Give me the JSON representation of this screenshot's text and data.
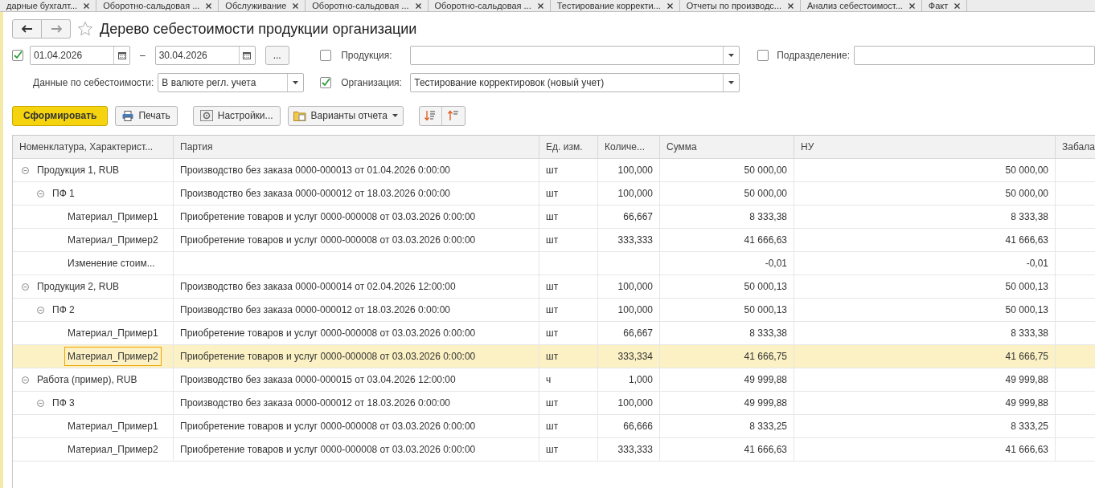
{
  "open_tabs": [
    {
      "label": "дарные бухгалт...",
      "selected": false
    },
    {
      "label": "Оборотно-сальдовая ...",
      "selected": false
    },
    {
      "label": "Обслуживание",
      "selected": false
    },
    {
      "label": "Оборотно-сальдовая ...",
      "selected": false
    },
    {
      "label": "Оборотно-сальдовая ...",
      "selected": false
    },
    {
      "label": "Тестирование корректи...",
      "selected": false
    },
    {
      "label": "Отчеты по производс...",
      "selected": false
    },
    {
      "label": "Анализ себестоимост...",
      "selected": false
    },
    {
      "label": "Факт",
      "selected": false
    }
  ],
  "window": {
    "title": "Дерево себестоимости продукции организации",
    "favorite": false
  },
  "period": {
    "enabled": true,
    "from": "01.04.2026",
    "dash": "–",
    "to": "30.04.2026",
    "more_button": "..."
  },
  "cost_data": {
    "label": "Данные по себестоимости:",
    "value": "В валюте регл. учета"
  },
  "filters": [
    {
      "label": "Продукция:",
      "checked": false
    },
    {
      "label": "Организация:",
      "checked": true,
      "value": "Тестирование корректировок (новый учет)"
    },
    {
      "label": "Подразделение:",
      "checked": false
    }
  ],
  "toolbar": {
    "generate": "Сформировать",
    "print": "Печать",
    "settings": "Настройки...",
    "variants": "Варианты отчета"
  },
  "table": {
    "columns": [
      "Номенклатура, Характерист...",
      "Партия",
      "Ед. изм.",
      "Количе...",
      "Сумма",
      "НУ",
      "Забала"
    ],
    "rows": [
      {
        "name": "Продукция 1, RUB",
        "batch": "Производство без заказа 0000-000013 от 01.04.2026 0:00:00",
        "unit": "шт",
        "qty": "100,000",
        "sum": "50 000,00",
        "nu": "50 000,00",
        "selected": false,
        "expanded": true,
        "children": [
          {
            "name": "ПФ 1",
            "batch": "Производство без заказа 0000-000012 от 18.03.2026 0:00:00",
            "unit": "шт",
            "qty": "100,000",
            "sum": "50 000,00",
            "nu": "50 000,00",
            "selected": false,
            "expanded": true,
            "children": [
              {
                "name": "Материал_Пример1",
                "batch": "Приобретение товаров и услуг 0000-000008 от 03.03.2026 0:00:00",
                "unit": "шт",
                "qty": "66,667",
                "sum": "8 333,38",
                "nu": "8 333,38",
                "selected": false
              },
              {
                "name": "Материал_Пример2",
                "batch": "Приобретение товаров и услуг 0000-000008 от 03.03.2026 0:00:00",
                "unit": "шт",
                "qty": "333,333",
                "sum": "41 666,63",
                "nu": "41 666,63",
                "selected": false
              },
              {
                "name": "Изменение стоим...",
                "sum": "-0,01",
                "nu": "-0,01",
                "selected": false
              }
            ]
          }
        ]
      },
      {
        "name": "Продукция 2, RUB",
        "batch": "Производство без заказа 0000-000014 от 02.04.2026 12:00:00",
        "unit": "шт",
        "qty": "100,000",
        "sum": "50 000,13",
        "nu": "50 000,13",
        "selected": false,
        "expanded": true,
        "children": [
          {
            "name": "ПФ 2",
            "batch": "Производство без заказа 0000-000012 от 18.03.2026 0:00:00",
            "unit": "шт",
            "qty": "100,000",
            "sum": "50 000,13",
            "nu": "50 000,13",
            "selected": false,
            "expanded": true,
            "children": [
              {
                "name": "Материал_Пример1",
                "batch": "Приобретение товаров и услуг 0000-000008 от 03.03.2026 0:00:00",
                "unit": "шт",
                "qty": "66,667",
                "sum": "8 333,38",
                "nu": "8 333,38",
                "selected": false
              },
              {
                "name": "Материал_Пример2",
                "batch": "Приобретение товаров и услуг 0000-000008 от 03.03.2026 0:00:00",
                "unit": "шт",
                "qty": "333,334",
                "sum": "41 666,75",
                "nu": "41 666,75",
                "selected": true
              }
            ]
          }
        ]
      },
      {
        "name": "Работа (пример), RUB",
        "batch": "Производство без заказа 0000-000015 от 03.04.2026 12:00:00",
        "unit": "ч",
        "qty": "1,000",
        "sum": "49 999,88",
        "nu": "49 999,88",
        "selected": false,
        "expanded": true,
        "children": [
          {
            "name": "ПФ 3",
            "batch": "Производство без заказа 0000-000012 от 18.03.2026 0:00:00",
            "unit": "шт",
            "qty": "100,000",
            "sum": "49 999,88",
            "nu": "49 999,88",
            "selected": false,
            "expanded": true,
            "children": [
              {
                "name": "Материал_Пример1",
                "batch": "Приобретение товаров и услуг 0000-000008 от 03.03.2026 0:00:00",
                "unit": "шт",
                "qty": "66,666",
                "sum": "8 333,25",
                "nu": "8 333,25",
                "selected": false
              },
              {
                "name": "Материал_Пример2",
                "batch": "Приобретение товаров и услуг 0000-000008 от 03.03.2026 0:00:00",
                "unit": "шт",
                "qty": "333,333",
                "sum": "41 666,63",
                "nu": "41 666,63",
                "selected": false
              }
            ]
          }
        ]
      }
    ]
  }
}
